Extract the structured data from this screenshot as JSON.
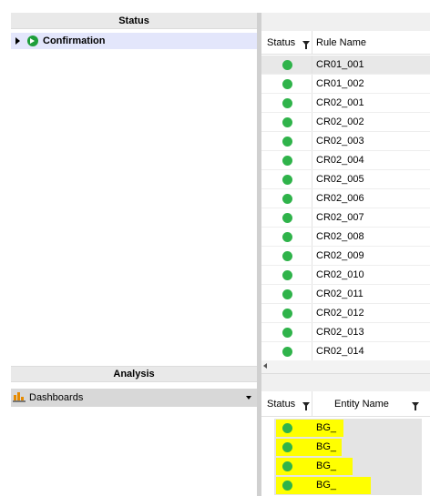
{
  "left_panel": {
    "status_header": "Status",
    "tree": [
      {
        "label": "Confirmation",
        "expanded": false,
        "icon": "green-arrow-circle-icon"
      }
    ],
    "analysis_header": "Analysis",
    "dashboards": {
      "label": "Dashboards",
      "icon": "dashboard-chart-icon",
      "dropdown": true
    }
  },
  "rules_grid": {
    "columns": [
      "Status",
      "Rule Name"
    ],
    "rows": [
      {
        "status": "green",
        "name": "CR01_001"
      },
      {
        "status": "green",
        "name": "CR01_002"
      },
      {
        "status": "green",
        "name": "CR02_001"
      },
      {
        "status": "green",
        "name": "CR02_002"
      },
      {
        "status": "green",
        "name": "CR02_003"
      },
      {
        "status": "green",
        "name": "CR02_004"
      },
      {
        "status": "green",
        "name": "CR02_005"
      },
      {
        "status": "green",
        "name": "CR02_006"
      },
      {
        "status": "green",
        "name": "CR02_007"
      },
      {
        "status": "green",
        "name": "CR02_008"
      },
      {
        "status": "green",
        "name": "CR02_009"
      },
      {
        "status": "green",
        "name": "CR02_010"
      },
      {
        "status": "green",
        "name": "CR02_011"
      },
      {
        "status": "green",
        "name": "CR02_012"
      },
      {
        "status": "green",
        "name": "CR02_013"
      },
      {
        "status": "green",
        "name": "CR02_014"
      }
    ]
  },
  "entity_grid": {
    "columns": [
      "Status",
      "Entity Name"
    ],
    "rows": [
      {
        "status": "green",
        "name": "BG_"
      },
      {
        "status": "green",
        "name": "BG_"
      },
      {
        "status": "green",
        "name": "BG_"
      },
      {
        "status": "green",
        "name": "BG_"
      }
    ]
  },
  "colors": {
    "status_green": "#2fb34a",
    "selection": "#e3e6fb",
    "highlight": "#ffff00"
  }
}
